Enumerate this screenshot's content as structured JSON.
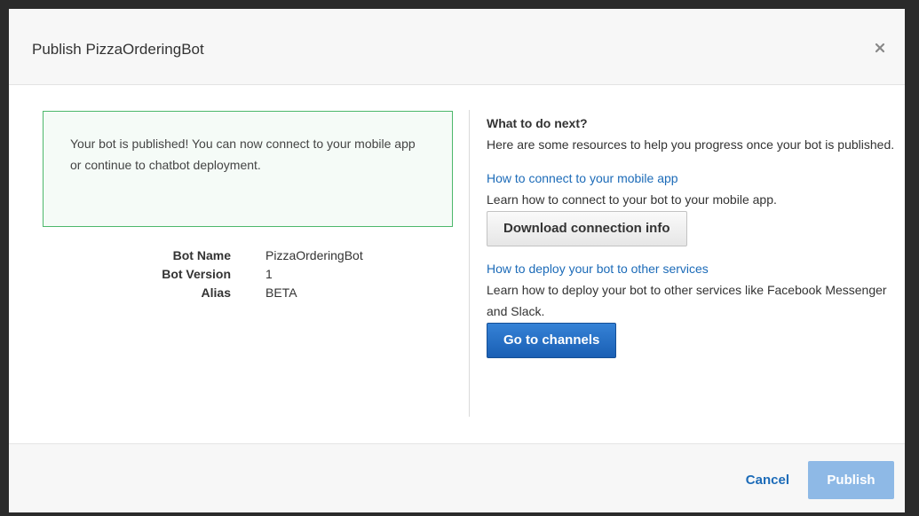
{
  "modal": {
    "title": "Publish PizzaOrderingBot",
    "close_icon": "close-icon"
  },
  "success": {
    "message": "Your bot is published! You can now connect to your mobile app or continue to chatbot deployment."
  },
  "details": [
    {
      "label": "Bot Name",
      "value": "PizzaOrderingBot"
    },
    {
      "label": "Bot Version",
      "value": "1"
    },
    {
      "label": "Alias",
      "value": "BETA"
    }
  ],
  "next": {
    "heading": "What to do next?",
    "intro": "Here are some resources to help you progress once your bot is published.",
    "mobile": {
      "link": "How to connect to your mobile app",
      "desc": "Learn how to connect to your bot to your mobile app.",
      "button": "Download connection info"
    },
    "services": {
      "link": "How to deploy your bot to other services",
      "desc": "Learn how to deploy your bot to other services like Facebook Messenger and Slack.",
      "button": "Go to channels"
    }
  },
  "footer": {
    "cancel": "Cancel",
    "publish": "Publish"
  },
  "colors": {
    "success_border": "#4cb86b",
    "link": "#1c6bb8",
    "primary": "#1a5fb4",
    "publish_disabled": "#8eb9e6"
  }
}
